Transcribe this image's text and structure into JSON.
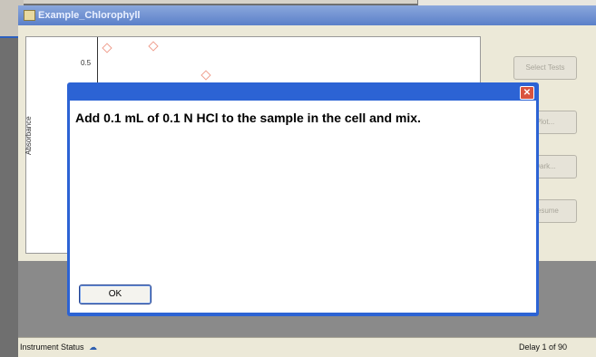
{
  "window": {
    "title": "Example_Chlorophyll"
  },
  "chart": {
    "ylabel": "Absorbance",
    "tick": "0.5"
  },
  "side_buttons": [
    "Select Tests",
    "Plot...",
    "Dark...",
    "Resume"
  ],
  "dialog": {
    "message": "Add 0.1 mL of 0.1 N HCl to the sample in the cell  and mix.",
    "ok_label": "OK",
    "close_glyph": "✕"
  },
  "status": {
    "left": "Instrument Status",
    "right": "Delay 1 of 90"
  },
  "colors": {
    "title_bar": "#5b80c9",
    "dialog_frame": "#2c63d4",
    "data_point": "#f0a090"
  }
}
